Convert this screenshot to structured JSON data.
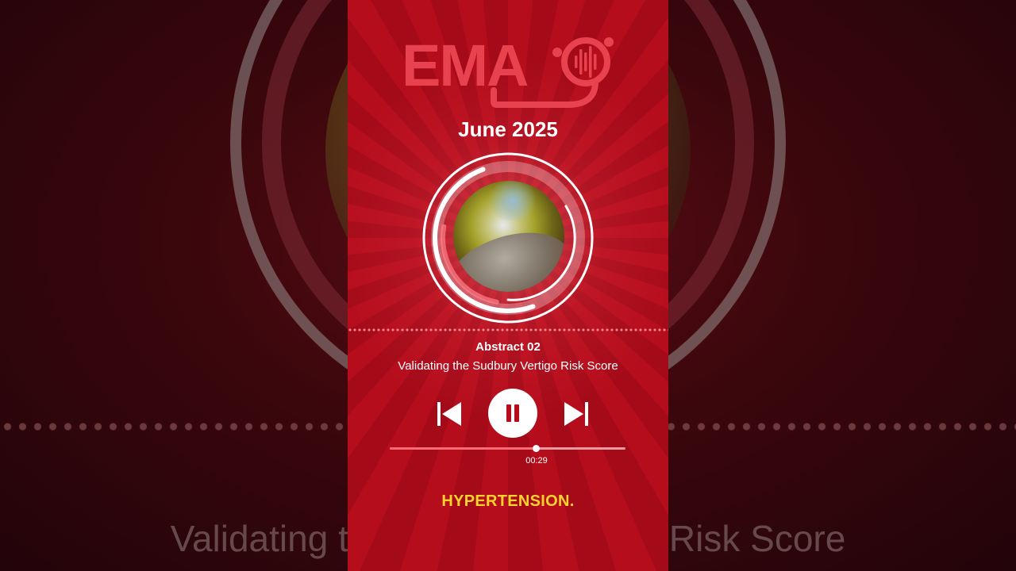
{
  "brand": {
    "logo_text": "EMA",
    "accent": "#e8424e"
  },
  "episode": {
    "month": "June 2025",
    "abstract_label": "Abstract 02",
    "title": "Validating the Sudbury Vertigo Risk Score",
    "caption": "HYPERTENSION."
  },
  "player": {
    "elapsed": "00:29",
    "progress": 0.62,
    "state": "playing",
    "controls": {
      "previous": "skip-previous-icon",
      "play_pause": "pause-icon",
      "next": "skip-next-icon"
    }
  },
  "colors": {
    "panel_bg": "#b50d1c",
    "caption": "#ffd32e",
    "progress_fill": "#ff6a76",
    "progress_track": "#e79aa1"
  }
}
